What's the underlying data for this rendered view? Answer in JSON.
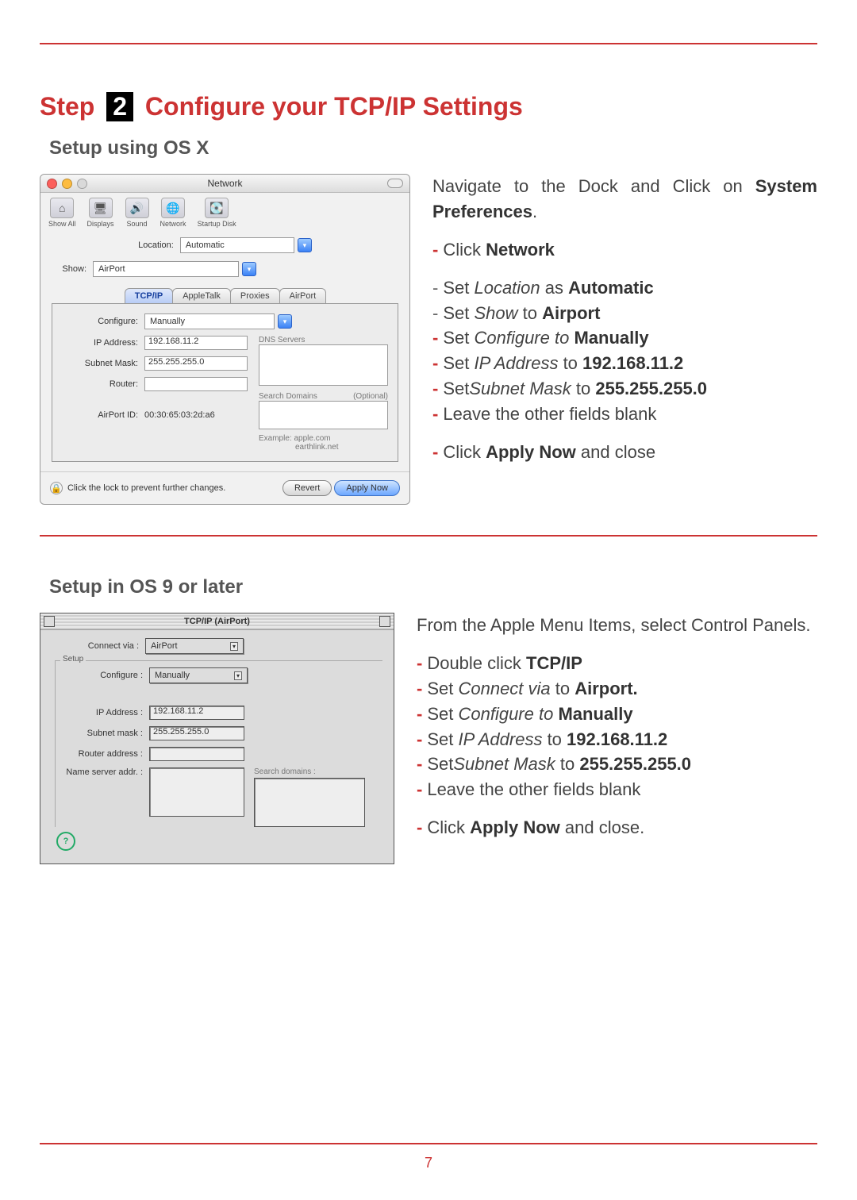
{
  "page_number": "7",
  "step": {
    "prefix": "Step",
    "number": "2",
    "title": "Configure your TCP/IP Settings"
  },
  "section1": {
    "heading": "Setup using OS X",
    "instructions_intro_a": "Navigate to the Dock and Click on ",
    "instructions_intro_b": "System Preferences",
    "click_network_a": "Click ",
    "click_network_b": "Network",
    "b_loc_a": "Set ",
    "b_loc_i": "Location",
    "b_loc_m": " as ",
    "b_loc_b": "Automatic",
    "b_show_a": "Set ",
    "b_show_i": "Show",
    "b_show_m": " to ",
    "b_show_b": "Airport",
    "b_conf_a": "Set ",
    "b_conf_i": "Configure to",
    "b_conf_b": " Manually",
    "b_ip_a": "Set ",
    "b_ip_i": "IP Address",
    "b_ip_m": " to ",
    "b_ip_b": "192.168.11.2",
    "b_sm_a": "Set",
    "b_sm_i": "Subnet Mask",
    "b_sm_m": " to ",
    "b_sm_b": "255.255.255.0",
    "b_blank": "Leave the other fields blank",
    "b_apply_a": "Click ",
    "b_apply_b": "Apply Now",
    "b_apply_c": " and close"
  },
  "osx_win": {
    "title": "Network",
    "toolbar": [
      "Show All",
      "Displays",
      "Sound",
      "Network",
      "Startup Disk"
    ],
    "location_label": "Location:",
    "location_value": "Automatic",
    "show_label": "Show:",
    "show_value": "AirPort",
    "tabs": [
      "TCP/IP",
      "AppleTalk",
      "Proxies",
      "AirPort"
    ],
    "configure_label": "Configure:",
    "configure_value": "Manually",
    "ip_label": "IP Address:",
    "ip_value": "192.168.11.2",
    "subnet_label": "Subnet Mask:",
    "subnet_value": "255.255.255.0",
    "router_label": "Router:",
    "dns_label": "DNS Servers",
    "sd_label": "Search Domains",
    "sd_hint": "(Optional)",
    "airportid_label": "AirPort ID:",
    "airportid_value": "00:30:65:03:2d:a6",
    "example_label": "Example:",
    "example_value1": "apple.com",
    "example_value2": "earthlink.net",
    "lock_text": "Click the lock to prevent further changes.",
    "btn_revert": "Revert",
    "btn_apply": "Apply Now"
  },
  "section2": {
    "heading": "Setup in OS 9 or later",
    "intro": "From the Apple Menu Items, select Control Panels.",
    "b_tcp_a": "Double click ",
    "b_tcp_b": "TCP/IP",
    "b_cv_a": "Set ",
    "b_cv_i": "Connect via",
    "b_cv_m": " to ",
    "b_cv_b": "Airport.",
    "b_conf_a": "Set ",
    "b_conf_i": "Configure to",
    "b_conf_b": " Manually",
    "b_ip_a": "Set ",
    "b_ip_i": "IP Address",
    "b_ip_m": " to ",
    "b_ip_b": "192.168.11.2",
    "b_sm_a": "Set",
    "b_sm_i": "Subnet Mask",
    "b_sm_m": " to ",
    "b_sm_b": "255.255.255.0",
    "b_blank": "Leave the other fields blank",
    "b_apply_a": "Click ",
    "b_apply_b": "Apply Now",
    "b_apply_c": " and close."
  },
  "os9_win": {
    "title": "TCP/IP (AirPort)",
    "connect_label": "Connect via :",
    "connect_value": "AirPort",
    "setup_legend": "Setup",
    "configure_label": "Configure :",
    "configure_value": "Manually",
    "ip_label": "IP Address :",
    "ip_value": "192.168.11.2",
    "subnet_label": "Subnet mask :",
    "subnet_value": "255.255.255.0",
    "router_label": "Router address :",
    "ns_label": "Name server addr. :",
    "sd_label": "Search domains :"
  }
}
